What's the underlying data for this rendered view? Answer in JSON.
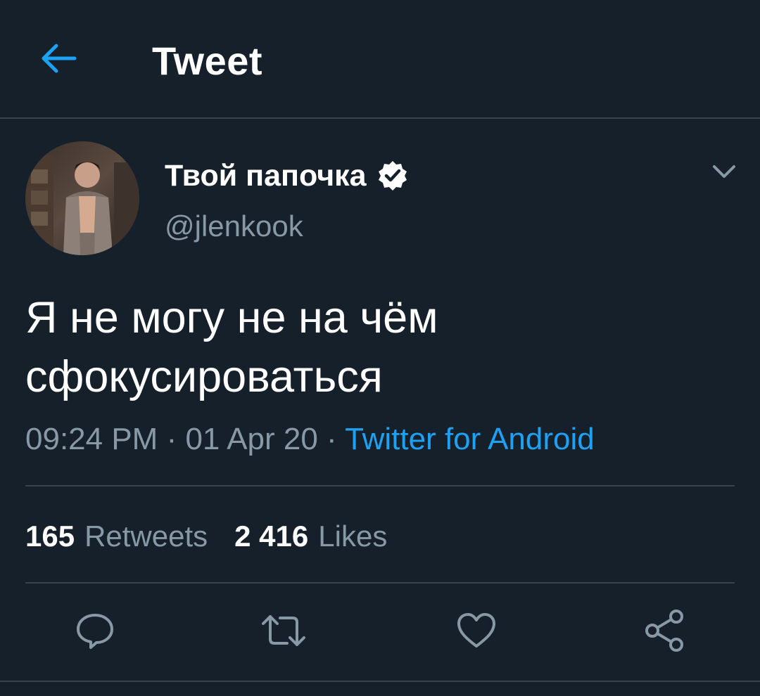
{
  "header": {
    "title": "Tweet",
    "back_icon": "arrow-left-icon"
  },
  "author": {
    "display_name": "Твой папочка",
    "handle": "@jlenkook",
    "verified": true
  },
  "tweet": {
    "text_lines": [
      "Я не могу не на чём",
      "сфокусироваться"
    ],
    "time": "09:24 PM",
    "separator1": " · ",
    "date": "01 Apr 20",
    "separator2": " · ",
    "source": "Twitter for Android"
  },
  "stats": {
    "retweets_count": "165",
    "retweets_label": "Retweets",
    "likes_count": "2 416",
    "likes_label": "Likes"
  },
  "actions": [
    "reply-icon",
    "retweet-icon",
    "like-icon",
    "share-icon"
  ],
  "colors": {
    "background": "#15202b",
    "accent": "#1da1f2",
    "secondary_text": "#8899a6",
    "divider": "#38444d"
  }
}
